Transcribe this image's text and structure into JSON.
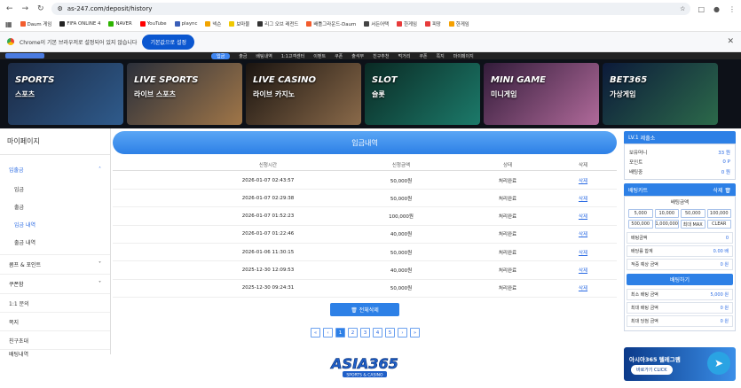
{
  "browser": {
    "url": "as-247.com/deposit/history",
    "bookmarks": [
      {
        "label": "Daum 게임",
        "color": "#f25c2d"
      },
      {
        "label": "FIFA ONLINE 4",
        "color": "#222222"
      },
      {
        "label": "NAVER",
        "color": "#2db400"
      },
      {
        "label": "YouTube",
        "color": "#ff0000"
      },
      {
        "label": "plaync",
        "color": "#3a5fb8"
      },
      {
        "label": "넥슨",
        "color": "#f2a400"
      },
      {
        "label": "보마물",
        "color": "#f0c800"
      },
      {
        "label": "리그 오브 레전드",
        "color": "#333333"
      },
      {
        "label": "배틀그라운드-Daum",
        "color": "#f25c2d"
      },
      {
        "label": "서든어택",
        "color": "#444444"
      },
      {
        "label": "한게임",
        "color": "#e73b3b"
      },
      {
        "label": "피망",
        "color": "#e73b3b"
      },
      {
        "label": "한게임",
        "color": "#f5a000"
      }
    ],
    "notice_text": "Chrome이 기본 브라우저로 설정되어 있지 않습니다",
    "notice_button": "기본값으로 설정"
  },
  "site_nav": {
    "items": [
      "입금",
      "출금",
      "배팅내역",
      "1:1고객센터",
      "이벤트",
      "쿠폰",
      "출석부",
      "친구추천",
      "먹거리",
      "쿠폰",
      "쪽지",
      "마이페이지"
    ]
  },
  "banners": [
    {
      "title": "SPORTS",
      "sub": "스포츠",
      "c1": "#1b2a44",
      "c2": "#2f5b8c"
    },
    {
      "title": "LIVE SPORTS",
      "sub": "라이브 스포츠",
      "c1": "#2a2f3a",
      "c2": "#a07648"
    },
    {
      "title": "LIVE CASINO",
      "sub": "라이브 카지노",
      "c1": "#1a1410",
      "c2": "#8a6a4a"
    },
    {
      "title": "SLOT",
      "sub": "슬롯",
      "c1": "#0a2a24",
      "c2": "#1c7a6a"
    },
    {
      "title": "MINI GAME",
      "sub": "미니게임",
      "c1": "#331c3a",
      "c2": "#b06a9a"
    },
    {
      "title": "BET365",
      "sub": "가상게임",
      "c1": "#0c1a3a",
      "c2": "#2c6a4a"
    }
  ],
  "sidebar": {
    "title": "마이페이지",
    "section_deposit": "입출금",
    "sub_items": [
      "입금",
      "출금",
      "입금 내역",
      "출금 내역"
    ],
    "section_points": "콤프 & 포인트",
    "section_coupon": "쿠폰함",
    "items": [
      "1:1 문의",
      "쪽지",
      "친구초대",
      "배팅내역"
    ]
  },
  "main": {
    "title": "입금내역",
    "columns": [
      "신청시간",
      "신청금액",
      "상태",
      "삭제"
    ],
    "rows": [
      {
        "time": "2026-01-07 02:43:57",
        "amount": "50,000원",
        "status": "처리완료",
        "action": "삭제"
      },
      {
        "time": "2026-01-07 02:29:38",
        "amount": "50,000원",
        "status": "처리완료",
        "action": "삭제"
      },
      {
        "time": "2026-01-07 01:52:23",
        "amount": "100,000원",
        "status": "처리완료",
        "action": "삭제"
      },
      {
        "time": "2026-01-07 01:22:46",
        "amount": "40,000원",
        "status": "처리완료",
        "action": "삭제"
      },
      {
        "time": "2026-01-06 11:30:15",
        "amount": "50,000원",
        "status": "처리완료",
        "action": "삭제"
      },
      {
        "time": "2025-12-30 12:09:53",
        "amount": "40,000원",
        "status": "처리완료",
        "action": "삭제"
      },
      {
        "time": "2025-12-30 09:24:31",
        "amount": "50,000원",
        "status": "처리완료",
        "action": "삭제"
      }
    ],
    "delete_all": "🗑 전체삭제",
    "pages": [
      "«",
      "‹",
      "1",
      "2",
      "3",
      "4",
      "5",
      "›",
      "»"
    ],
    "current_page": "1"
  },
  "right_panel": {
    "level": "LV.1",
    "username": "제출소",
    "balance_label": "보유머니",
    "balance_value": "33 원",
    "point_label": "포인트",
    "point_value": "0 P",
    "bet_label": "배팅중",
    "bet_value": "0 원",
    "cart_title": "배팅카트",
    "cart_delete": "삭제 🗑",
    "amount_title": "배팅금액",
    "chips": [
      "5,000",
      "10,000",
      "50,000",
      "100,000",
      "500,000",
      "1,000,000",
      "최대 MAX",
      "CLEAR"
    ],
    "bet_amount_label": "배팅금액",
    "bet_amount_value": "0",
    "odds_label": "배당률 합계",
    "odds_value": "0.00 배",
    "expected_label": "적중 예상 금액",
    "expected_value": "0 원",
    "bet_button": "배팅하기",
    "min_label": "최소 배팅 금액",
    "min_value": "5,000 원",
    "max_label": "최대 배팅 금액",
    "max_value": "0 원",
    "max_win_label": "최대 당첨 금액",
    "max_win_value": "0 원"
  },
  "telegram": {
    "title": "아시아365 텔레그램",
    "button": "바로가기 CLICK"
  },
  "footer": {
    "logo": "ASIA365",
    "logo_sub": "SPORTS & CASINO"
  }
}
